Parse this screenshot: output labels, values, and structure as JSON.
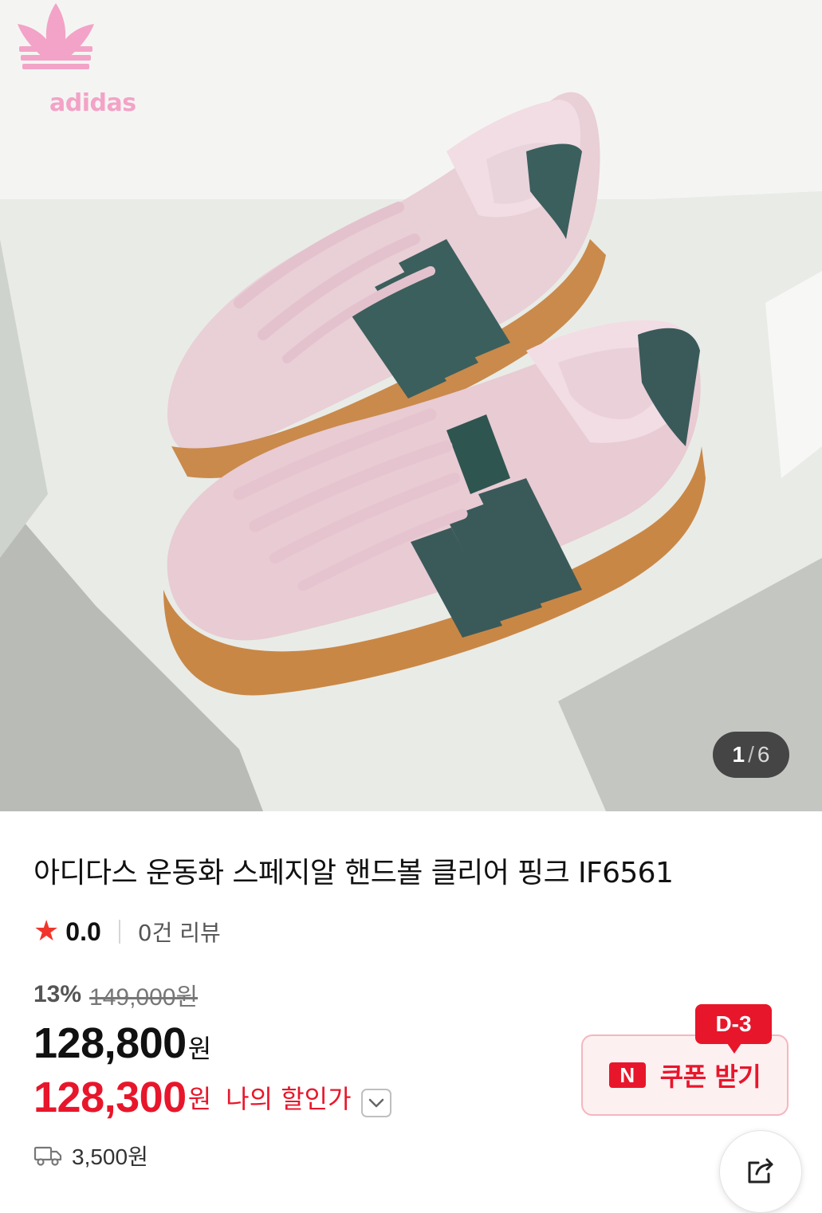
{
  "gallery": {
    "brand_logo_text": "adidas",
    "image_subject": "pink suede sneakers with green stripes",
    "counter": {
      "current": "1",
      "separator": "/",
      "total": "6"
    }
  },
  "product": {
    "title": "아디다스 운동화 스페지알 핸드볼 클리어 핑크 IF6561",
    "rating": {
      "icon": "star-icon",
      "value": "0.0",
      "review_count": "0건 리뷰"
    },
    "price": {
      "discount_rate": "13%",
      "original": "149,000원",
      "sale_number": "128,800",
      "sale_unit": "원",
      "my_number": "128,300",
      "my_unit": "원",
      "my_label": "나의 할인가"
    },
    "shipping": {
      "icon": "delivery-truck-icon",
      "cost": "3,500원"
    }
  },
  "coupon": {
    "badge": "D-3",
    "icon": "naver-n-icon",
    "icon_text": "N",
    "label": "쿠폰 받기"
  },
  "share": {
    "icon": "share-icon"
  },
  "colors": {
    "accent_red": "#e8162b",
    "logo_pink": "#f3a3c7",
    "coupon_bg": "#fdf0f1"
  }
}
